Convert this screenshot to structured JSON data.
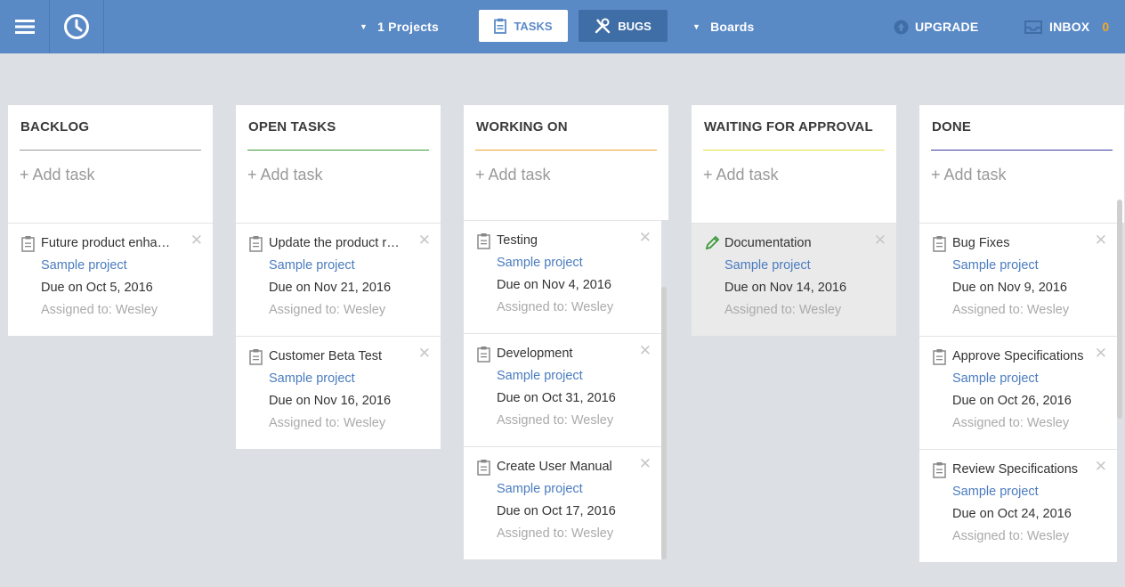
{
  "topbar": {
    "projects_label": "1 Projects",
    "tasks_label": "TASKS",
    "bugs_label": "BUGS",
    "boards_label": "Boards",
    "upgrade_label": "UPGRADE",
    "inbox_label": "INBOX",
    "inbox_count": "0"
  },
  "columns": [
    {
      "title": "BACKLOG",
      "accent": "#999999",
      "add_label": "+ Add task",
      "cards": [
        {
          "title": "Future product enhancements",
          "project": "Sample project",
          "due": "Due on Oct 5, 2016",
          "assigned": "Assigned to: Wesley"
        }
      ]
    },
    {
      "title": "OPEN TASKS",
      "accent": "#3a9a3a",
      "add_label": "+ Add task",
      "cards": [
        {
          "title": "Update the product roadmap",
          "project": "Sample project",
          "due": "Due on Nov 21, 2016",
          "assigned": "Assigned to: Wesley"
        },
        {
          "title": "Customer Beta Test",
          "project": "Sample project",
          "due": "Due on Nov 16, 2016",
          "assigned": "Assigned to: Wesley"
        }
      ]
    },
    {
      "title": "WORKING ON",
      "accent": "#f0a030",
      "add_label": "+ Add task",
      "cards": [
        {
          "title": "Testing",
          "project": "Sample project",
          "due": "Due on Nov 4, 2016",
          "assigned": "Assigned to: Wesley"
        },
        {
          "title": "Development",
          "project": "Sample project",
          "due": "Due on Oct 31, 2016",
          "assigned": "Assigned to: Wesley"
        },
        {
          "title": "Create User Manual",
          "project": "Sample project",
          "due": "Due on Oct 17, 2016",
          "assigned": "Assigned to: Wesley"
        }
      ]
    },
    {
      "title": "WAITING FOR APPROVAL",
      "accent": "#e8e040",
      "add_label": "+ Add task",
      "cards": [
        {
          "title": "Documentation",
          "project": "Sample project",
          "due": "Due on Nov 14, 2016",
          "assigned": "Assigned to: Wesley"
        }
      ]
    },
    {
      "title": "DONE",
      "accent": "#3a3aa0",
      "add_label": "+ Add task",
      "cards": [
        {
          "title": "Bug Fixes",
          "project": "Sample project",
          "due": "Due on Nov 9, 2016",
          "assigned": "Assigned to: Wesley"
        },
        {
          "title": "Approve Specifications",
          "project": "Sample project",
          "due": "Due on Oct 26, 2016",
          "assigned": "Assigned to: Wesley"
        },
        {
          "title": "Review Specifications",
          "project": "Sample project",
          "due": "Due on Oct 24, 2016",
          "assigned": "Assigned to: Wesley"
        }
      ]
    }
  ]
}
